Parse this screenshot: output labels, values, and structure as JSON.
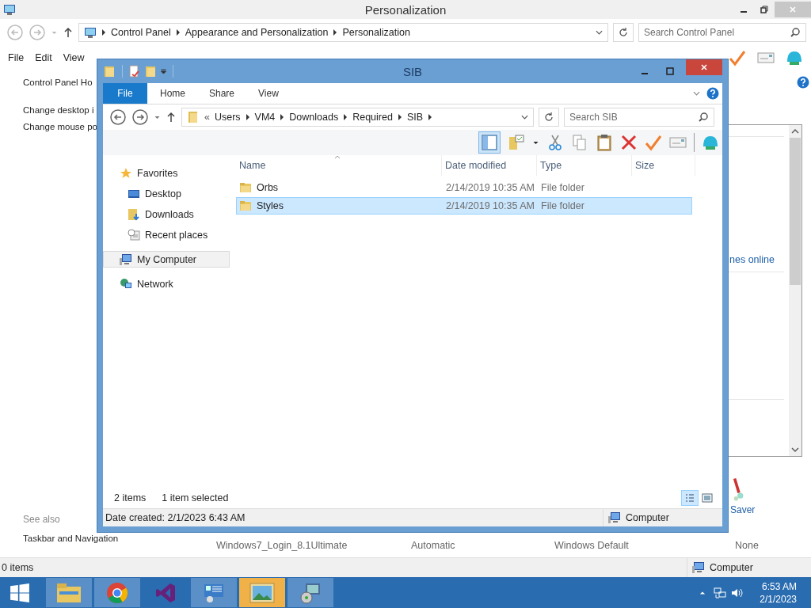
{
  "window": {
    "title": "Personalization"
  },
  "address_bar": {
    "crumbs": [
      "Control Panel",
      "Appearance and Personalization",
      "Personalization"
    ],
    "search": {
      "placeholder": "Search Control Panel"
    }
  },
  "menu": [
    "File",
    "Edit",
    "View"
  ],
  "left_pane": {
    "links": [
      "Control Panel Ho",
      "Change desktop i",
      "Change mouse po"
    ],
    "see_also": "See also",
    "see_also_links": [
      "Taskbar and Navigation"
    ]
  },
  "right_panel": {
    "link": "nes online",
    "saver_link": "Saver"
  },
  "theme_row": [
    "Windows7_Login_8.1Ultimate",
    "Automatic",
    "Windows Default",
    "None"
  ],
  "status_bar": {
    "items": "0 items",
    "location": "Computer"
  },
  "explorer": {
    "title": "SIB",
    "ribbon_tabs": [
      {
        "label": "File",
        "kind": "file"
      },
      {
        "label": "Home",
        "kind": "tab"
      },
      {
        "label": "Share",
        "kind": "tab"
      },
      {
        "label": "View",
        "kind": "tab"
      }
    ],
    "breadcrumb": {
      "overflow": "«",
      "crumbs": [
        "Users",
        "VM4",
        "Downloads",
        "Required",
        "SIB"
      ]
    },
    "search": {
      "placeholder": "Search SIB"
    },
    "nav": [
      {
        "label": "Favorites",
        "kind": "star",
        "selected": false,
        "children": [
          {
            "label": "Desktop",
            "kind": "desktop",
            "selected": false
          },
          {
            "label": "Downloads",
            "kind": "downloads",
            "selected": false
          },
          {
            "label": "Recent places",
            "kind": "recent",
            "selected": false
          }
        ]
      },
      {
        "label": "My Computer",
        "kind": "computer",
        "selected": true
      },
      {
        "label": "Network",
        "kind": "network",
        "selected": false
      }
    ],
    "columns": [
      "Name",
      "Date modified",
      "Type",
      "Size"
    ],
    "rows": [
      {
        "name": "Orbs",
        "date": "2/14/2019 10:35 AM",
        "type": "File folder",
        "selected": false
      },
      {
        "name": "Styles",
        "date": "2/14/2019 10:35 AM",
        "type": "File folder",
        "selected": true
      }
    ],
    "item_count": "2 items",
    "selection_count": "1 item selected",
    "status": {
      "date_created": "Date created: 2/1/2023 6:43 AM",
      "location": "Computer"
    }
  },
  "taskbar": {
    "apps": [
      {
        "kind": "explorer",
        "running": true,
        "selected": false
      },
      {
        "kind": "browser",
        "running": true,
        "selected": false
      },
      {
        "kind": "studio",
        "running": false,
        "selected": false
      },
      {
        "kind": "control",
        "running": true,
        "selected": false
      },
      {
        "kind": "photo",
        "running": true,
        "selected": true
      },
      {
        "kind": "installer",
        "running": true,
        "selected": false
      }
    ],
    "time": "6:53 AM",
    "date": "2/1/2023"
  }
}
